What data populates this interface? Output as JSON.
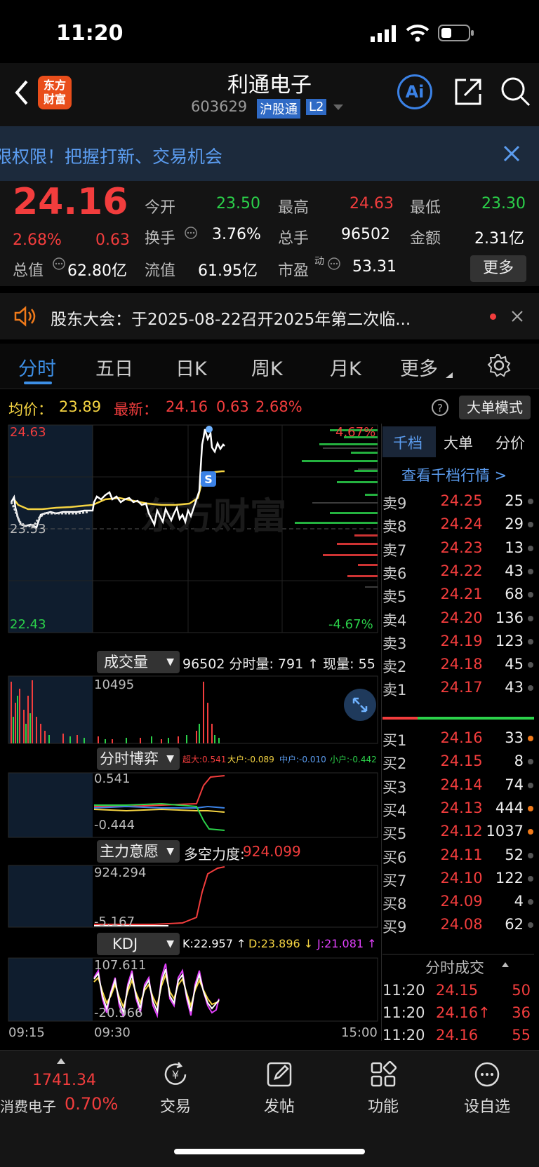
{
  "status_bar": {
    "time": "11:20"
  },
  "header": {
    "title": "利通电子",
    "code": "603629",
    "exchange_tag": "沪股通",
    "level_tag": "L2",
    "logo_line1": "东方",
    "logo_line2": "财富",
    "ai_label": "Ai"
  },
  "banner": {
    "text": "限权限！把握打新、交易机会"
  },
  "quote": {
    "price": "24.16",
    "change_pct": "2.68%",
    "change_abs": "0.63",
    "open_label": "今开",
    "open": "23.50",
    "high_label": "最高",
    "high": "24.63",
    "low_label": "最低",
    "low": "23.30",
    "turnover_label": "换手",
    "turnover": "3.76%",
    "volume_label": "总手",
    "volume": "96502",
    "amount_label": "金额",
    "amount": "2.31亿",
    "mcap_label": "总值",
    "mcap": "62.80亿",
    "float_label": "流值",
    "float_cap": "61.95亿",
    "pe_label": "市盈",
    "pe_sup": "动",
    "pe": "53.31",
    "more_btn": "更多"
  },
  "notice": {
    "text": "股东大会：于2025-08-22召开2025年第二次临..."
  },
  "tabs": [
    "分时",
    "五日",
    "日K",
    "周K",
    "月K",
    "更多"
  ],
  "chart_header": {
    "avg_label": "均价：",
    "avg": "23.89",
    "latest_label": "最新：",
    "latest": "24.16",
    "chg": "0.63",
    "chg_pct": "2.68%",
    "mode_btn": "大单模式"
  },
  "chart": {
    "y_top": "24.63",
    "y_mid": "23.53",
    "y_bottom": "22.43",
    "pct_top": "4.67%",
    "pct_bottom": "-4.67%",
    "watermark": "东方财富",
    "vol_label": "成交量",
    "vol_info": "96502 分时量: 791 ↑ 现量: 55",
    "vol_max": "10495",
    "game_label": "分时博弈",
    "game_info_1": "超大:0.541",
    "game_info_2": "大户:-0.089",
    "game_info_3": "中户:-0.010",
    "game_info_4": "小户:-0.442",
    "game_top": "0.541",
    "game_bottom": "-0.444",
    "will_label": "主力意愿",
    "will_info_label": "多空力度:",
    "will_info": "924.099",
    "will_top": "924.294",
    "will_bottom": "-5.167",
    "kdj_label": "KDJ",
    "kdj_k": "K:22.957 ↑",
    "kdj_d": "D:23.896 ↓",
    "kdj_j": "J:21.081 ↑",
    "kdj_top": "107.611",
    "kdj_bottom": "-20.966",
    "time_start": "09:15",
    "time_open": "09:30",
    "time_end": "15:00"
  },
  "orderbook": {
    "tabs": [
      "千档",
      "大单",
      "分价"
    ],
    "link": "查看千档行情 >",
    "asks": [
      {
        "label": "卖9",
        "price": "24.25",
        "vol": "25"
      },
      {
        "label": "卖8",
        "price": "24.24",
        "vol": "29"
      },
      {
        "label": "卖7",
        "price": "24.23",
        "vol": "13"
      },
      {
        "label": "卖6",
        "price": "24.22",
        "vol": "43"
      },
      {
        "label": "卖5",
        "price": "24.21",
        "vol": "68"
      },
      {
        "label": "卖4",
        "price": "24.20",
        "vol": "136"
      },
      {
        "label": "卖3",
        "price": "24.19",
        "vol": "123"
      },
      {
        "label": "卖2",
        "price": "24.18",
        "vol": "45"
      },
      {
        "label": "卖1",
        "price": "24.17",
        "vol": "43"
      }
    ],
    "bids": [
      {
        "label": "买1",
        "price": "24.16",
        "vol": "33"
      },
      {
        "label": "买2",
        "price": "24.15",
        "vol": "8"
      },
      {
        "label": "买3",
        "price": "24.14",
        "vol": "74"
      },
      {
        "label": "买4",
        "price": "24.13",
        "vol": "444"
      },
      {
        "label": "买5",
        "price": "24.12",
        "vol": "1037"
      },
      {
        "label": "买6",
        "price": "24.11",
        "vol": "52"
      },
      {
        "label": "买7",
        "price": "24.10",
        "vol": "122"
      },
      {
        "label": "买8",
        "price": "24.09",
        "vol": "4"
      },
      {
        "label": "买9",
        "price": "24.08",
        "vol": "62"
      }
    ],
    "trades_title": "分时成交",
    "trades": [
      {
        "time": "11:20",
        "price": "24.15",
        "vol": "50"
      },
      {
        "time": "11:20",
        "price": "24.16↑",
        "vol": "36"
      },
      {
        "time": "11:20",
        "price": "24.16",
        "vol": "55"
      }
    ]
  },
  "bottom_nav": {
    "index_value": "1741.34",
    "index_name": "消费电子",
    "index_pct": "0.70%",
    "items": [
      "交易",
      "发帖",
      "功能",
      "设自选"
    ]
  }
}
